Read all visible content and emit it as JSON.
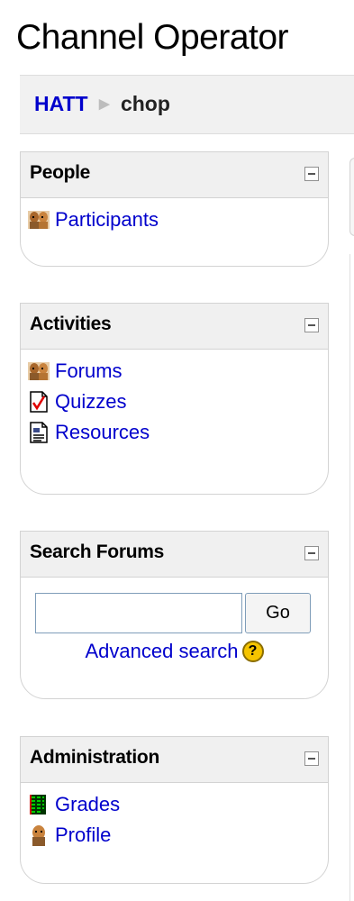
{
  "page": {
    "title": "Channel Operator"
  },
  "breadcrumb": {
    "home": "HATT",
    "separator": "▶",
    "current": "chop"
  },
  "blocks": {
    "people": {
      "title": "People",
      "items": [
        {
          "label": "Participants",
          "icon": "users-icon"
        }
      ]
    },
    "activities": {
      "title": "Activities",
      "items": [
        {
          "label": "Forums",
          "icon": "forum-icon"
        },
        {
          "label": "Quizzes",
          "icon": "quiz-icon"
        },
        {
          "label": "Resources",
          "icon": "resource-icon"
        }
      ]
    },
    "search": {
      "title": "Search Forums",
      "input_value": "",
      "go_label": "Go",
      "advanced_label": "Advanced search",
      "help_symbol": "?"
    },
    "administration": {
      "title": "Administration",
      "items": [
        {
          "label": "Grades",
          "icon": "grades-icon"
        },
        {
          "label": "Profile",
          "icon": "profile-icon"
        }
      ]
    }
  },
  "colors": {
    "link": "#0000cc",
    "header_bg": "#f0f0f0",
    "border": "#d3d3d3",
    "help_icon": "#f5c400"
  }
}
